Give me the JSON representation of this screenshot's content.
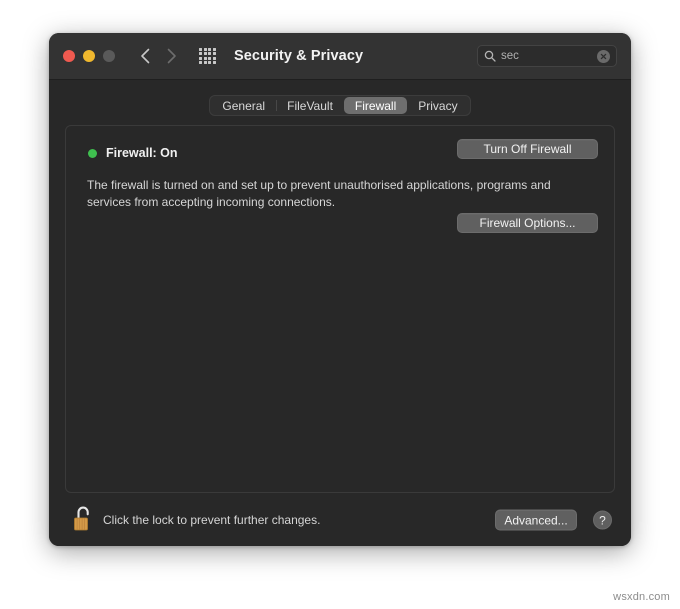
{
  "window": {
    "title": "Security & Privacy",
    "traffic_lights": [
      {
        "name": "close",
        "color": "#f05a50"
      },
      {
        "name": "minimize",
        "color": "#f0b82e"
      },
      {
        "name": "zoom",
        "color": "#5a5a5a"
      }
    ],
    "nav": {
      "back_icon": "chevron-left-icon",
      "forward_icon": "chevron-right-icon"
    },
    "grid_icon": "all-preferences-grid-icon"
  },
  "search": {
    "icon": "search-icon",
    "value": "sec",
    "placeholder": "Search",
    "clear_icon": "clear-circle-icon"
  },
  "tabs": [
    {
      "label": "General",
      "active": false
    },
    {
      "label": "FileVault",
      "active": false
    },
    {
      "label": "Firewall",
      "active": true
    },
    {
      "label": "Privacy",
      "active": false
    }
  ],
  "firewall": {
    "status_dot_color": "#3fbf4f",
    "status_label": "Firewall: On",
    "description": "The firewall is turned on and set up to prevent unauthorised applications, programs and services from accepting incoming connections.",
    "turn_off_button": "Turn Off Firewall",
    "options_button": "Firewall Options..."
  },
  "bottom": {
    "lock_icon": "unlocked-padlock-icon",
    "lock_text": "Click the lock to prevent further changes.",
    "advanced_button": "Advanced...",
    "help_button": "?"
  },
  "watermark": "wsxdn.com"
}
